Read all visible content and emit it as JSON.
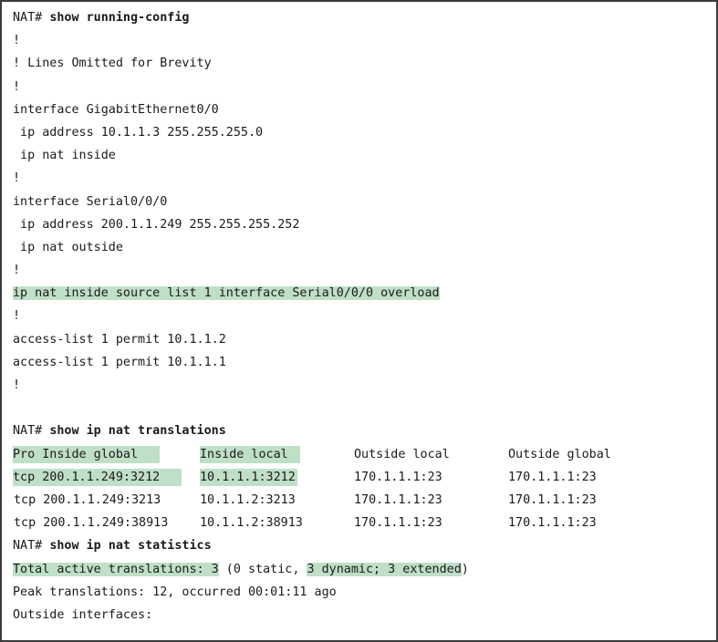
{
  "colors": {
    "highlight": "#bfdfc7",
    "text": "#1a1a1a",
    "border": "#3a3a3a"
  },
  "config": {
    "cmd_running": {
      "prompt": "NAT# ",
      "command": "show running-config"
    },
    "lines_a": [
      "!",
      "! Lines Omitted for Brevity",
      "!",
      "interface GigabitEthernet0/0",
      " ip address 10.1.1.3 255.255.255.0",
      " ip nat inside",
      "!",
      "interface Serial0/0/0",
      " ip address 200.1.1.249 255.255.255.252",
      " ip nat outside",
      "!"
    ],
    "nat_statement": "ip nat inside source list 1 interface Serial0/0/0 overload",
    "lines_b": [
      "!",
      "access-list 1 permit 10.1.1.2",
      "access-list 1 permit 10.1.1.1",
      "!"
    ]
  },
  "translations": {
    "cmd": {
      "prompt": "NAT# ",
      "command": "show ip nat translations"
    },
    "header": {
      "pro_inside_global": "Pro Inside global",
      "inside_local": "Inside local",
      "outside_local": "Outside local",
      "outside_global": "Outside global"
    },
    "rows": [
      {
        "pro_inside_global": "tcp 200.1.1.249:3212",
        "inside_local": "10.1.1.1:3212",
        "outside_local": "170.1.1.1:23",
        "outside_global": "170.1.1.1:23"
      },
      {
        "pro_inside_global": "tcp 200.1.1.249:3213",
        "inside_local": "10.1.1.2:3213",
        "outside_local": "170.1.1.1:23",
        "outside_global": "170.1.1.1:23"
      },
      {
        "pro_inside_global": "tcp 200.1.1.249:38913",
        "inside_local": "10.1.1.2:38913",
        "outside_local": "170.1.1.1:23",
        "outside_global": "170.1.1.1:23"
      }
    ]
  },
  "statistics": {
    "cmd": {
      "prompt": "NAT# ",
      "command": "show ip nat statistics"
    },
    "total_active": "Total active translations: 3",
    "static_part": " (0 static, ",
    "dynamic_part": "3 dynamic; 3 extended",
    "close_paren": ")",
    "peak": "Peak translations: 12, occurred 00:01:11 ago",
    "outside_interfaces": "Outside interfaces:"
  }
}
